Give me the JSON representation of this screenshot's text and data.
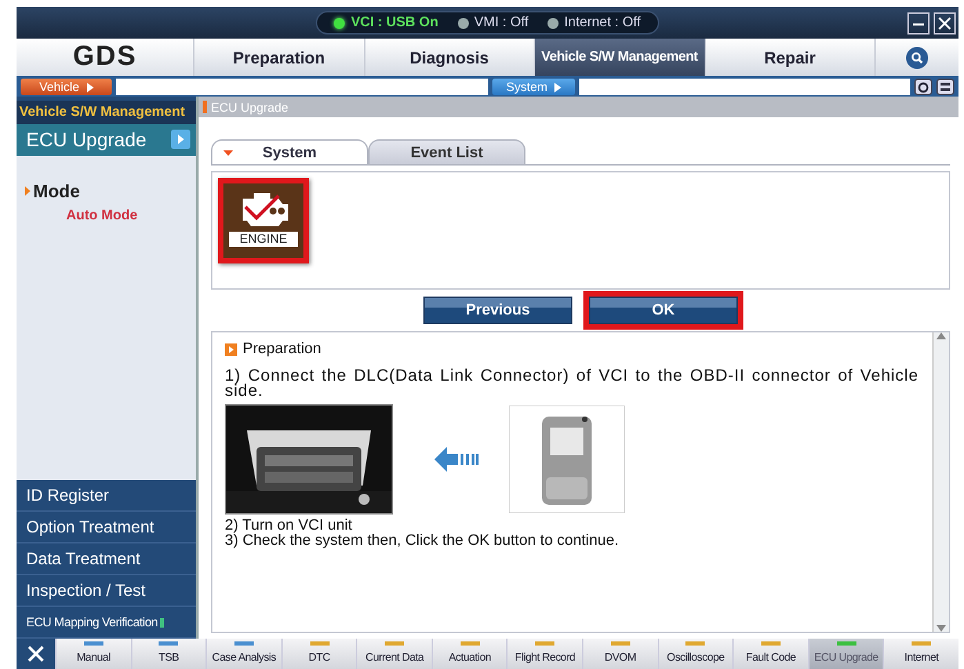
{
  "status": [
    {
      "label": "VCI : USB On",
      "on": true
    },
    {
      "label": "VMI : Off",
      "on": false
    },
    {
      "label": "Internet : Off",
      "on": false
    }
  ],
  "logo": "GDS",
  "nav": [
    {
      "label": "Preparation",
      "selected": false
    },
    {
      "label": "Diagnosis",
      "selected": false
    },
    {
      "label": "Vehicle S/W Management",
      "selected": true
    },
    {
      "label": "Repair",
      "selected": false
    }
  ],
  "subbar": {
    "vehicle": "Vehicle",
    "system": "System"
  },
  "sidebar": {
    "section": "Vehicle S/W Management",
    "header": "ECU Upgrade",
    "mode": "Mode",
    "mode_value": "Auto Mode",
    "items": [
      {
        "label": "ID Register",
        "kind": "large"
      },
      {
        "label": "Option Treatment",
        "kind": "large"
      },
      {
        "label": "Data Treatment",
        "kind": "large"
      },
      {
        "label": "Inspection / Test",
        "kind": "large"
      },
      {
        "label": "ECU Mapping Verification",
        "kind": "small"
      }
    ]
  },
  "breadcrumb": "ECU Upgrade",
  "tabs": [
    {
      "label": "System",
      "selected": true
    },
    {
      "label": "Event List",
      "selected": false
    }
  ],
  "systems": [
    {
      "label": "ENGINE",
      "selected": true
    }
  ],
  "buttons": [
    {
      "label": "Previous",
      "selected": false
    },
    {
      "label": "OK",
      "selected": true
    }
  ],
  "instructions": {
    "heading": "Preparation",
    "step_1": "1) Connect the DLC(Data Link Connector) of VCI to the OBD-II connector of Vehicle side.",
    "step_2": "2) Turn on VCI unit",
    "step_3": "3) Check the system then, Click the OK button to continue."
  },
  "toolbar": [
    {
      "label": "Manual",
      "color": "#4a8fd0",
      "selected": false
    },
    {
      "label": "TSB",
      "color": "#4a8fd0",
      "selected": false
    },
    {
      "label": "Case Analysis",
      "color": "#4a8fd0",
      "selected": false
    },
    {
      "label": "DTC",
      "color": "#e0a830",
      "selected": false
    },
    {
      "label": "Current Data",
      "color": "#e0a830",
      "selected": false
    },
    {
      "label": "Actuation",
      "color": "#e0a830",
      "selected": false
    },
    {
      "label": "Flight Record",
      "color": "#e0a830",
      "selected": false
    },
    {
      "label": "DVOM",
      "color": "#e0a830",
      "selected": false
    },
    {
      "label": "Oscilloscope",
      "color": "#e0a830",
      "selected": false
    },
    {
      "label": "Fault Code",
      "color": "#e0a830",
      "selected": false
    },
    {
      "label": "ECU Upgrade",
      "color": "#3cc040",
      "selected": true
    },
    {
      "label": "Internet",
      "color": "#e0a830",
      "selected": false
    }
  ]
}
